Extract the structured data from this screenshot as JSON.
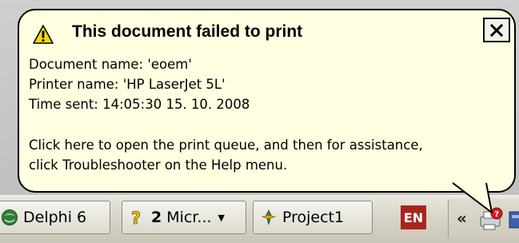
{
  "balloon": {
    "title": "This document failed to print",
    "lines": {
      "document": "Document name: 'eoem'",
      "printer": "Printer name: 'HP LaserJet 5L'",
      "time": "Time sent: 14:05:30  15. 10. 2008"
    },
    "message": {
      "line1": "Click here to open the print queue, and then for assistance,",
      "line2": "click Troubleshooter on the Help menu."
    },
    "close_label": "✕"
  },
  "taskbar": {
    "buttons": [
      {
        "label": "Delphi 6",
        "icon": "delphi-icon"
      },
      {
        "count": "2",
        "label": "Micr...",
        "icon": "help-question-icon"
      },
      {
        "label": "Project1",
        "icon": "delphi-project-icon"
      }
    ],
    "language": "EN",
    "tray": {
      "chevron": "«",
      "icons": [
        "printer-error-icon",
        "tray-app-icon"
      ]
    }
  },
  "colors": {
    "balloon_bg": "#ffffe1",
    "language_badge": "#a8251d",
    "warning_yellow": "#f5d90a"
  }
}
